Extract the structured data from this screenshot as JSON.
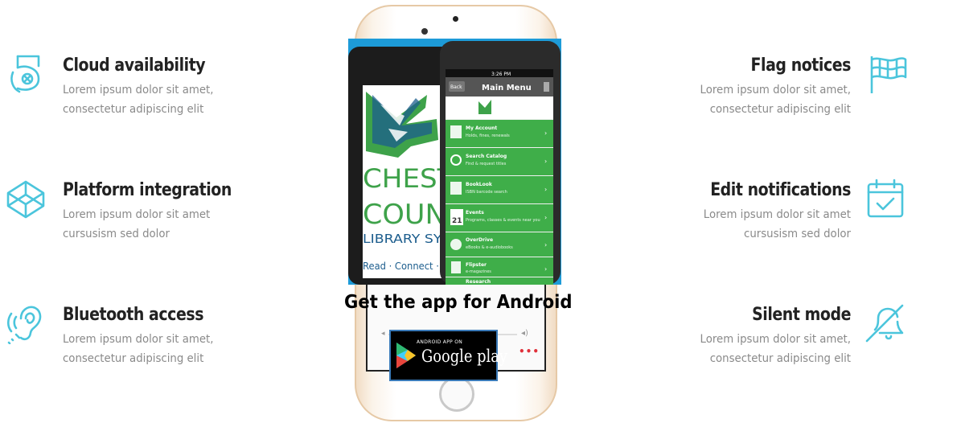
{
  "features_left": [
    {
      "title": "Cloud availability",
      "desc_line1": "Lorem ipsum dolor sit amet,",
      "desc_line2": "consectetur adipiscing elit",
      "icon": "cloud-5-icon"
    },
    {
      "title": "Platform integration",
      "desc_line1": "Lorem ipsum dolor sit amet",
      "desc_line2": "cursusism sed dolor",
      "icon": "codepen-cube-icon"
    },
    {
      "title": "Bluetooth access",
      "desc_line1": "Lorem ipsum dolor sit amet,",
      "desc_line2": "consectetur adipiscing elit",
      "icon": "hearing-ear-icon"
    }
  ],
  "features_right": [
    {
      "title": "Flag notices",
      "desc_line1": "Lorem ipsum dolor sit amet,",
      "desc_line2": "consectetur adipiscing elit",
      "icon": "checkered-flag-icon"
    },
    {
      "title": "Edit notifications",
      "desc_line1": "Lorem ipsum dolor sit amet",
      "desc_line2": "cursusism sed dolor",
      "icon": "calendar-check-icon"
    },
    {
      "title": "Silent mode",
      "desc_line1": "Lorem ipsum dolor sit amet,",
      "desc_line2": "consectetur adipiscing elit",
      "icon": "bell-off-icon"
    }
  ],
  "app_image": {
    "back_phone_brand_1": "CHESTE",
    "back_phone_brand_2": "COUNT",
    "back_phone_brand_3": "LIBRARY SYST",
    "back_phone_tagline": "Read · Connect · Disco",
    "front_phone_time": "3:26 PM",
    "front_phone_back": "Back",
    "front_phone_title": "Main Menu",
    "menu_items": [
      {
        "label": "My Account",
        "sub": "Holds, fines, renewals"
      },
      {
        "label": "Search Catalog",
        "sub": "Find & request titles"
      },
      {
        "label": "BookLook",
        "sub": "ISBN barcode search"
      },
      {
        "label": "Events",
        "sub": "Programs, classes & events near you"
      },
      {
        "label": "OverDrive",
        "sub": "eBooks & e-audiobooks"
      },
      {
        "label": "Flipster",
        "sub": "e-magazines"
      },
      {
        "label": "Research",
        "sub": ""
      }
    ],
    "events_day": "21"
  },
  "cta_text": "Get the app for Android",
  "badge": {
    "small_text": "ANDROID APP ON",
    "big_text": "Google play"
  },
  "colors": {
    "accent": "#4bc5dc",
    "menu_green": "#3fae49",
    "title_text": "#222222",
    "desc_text": "#8a8a8a"
  }
}
